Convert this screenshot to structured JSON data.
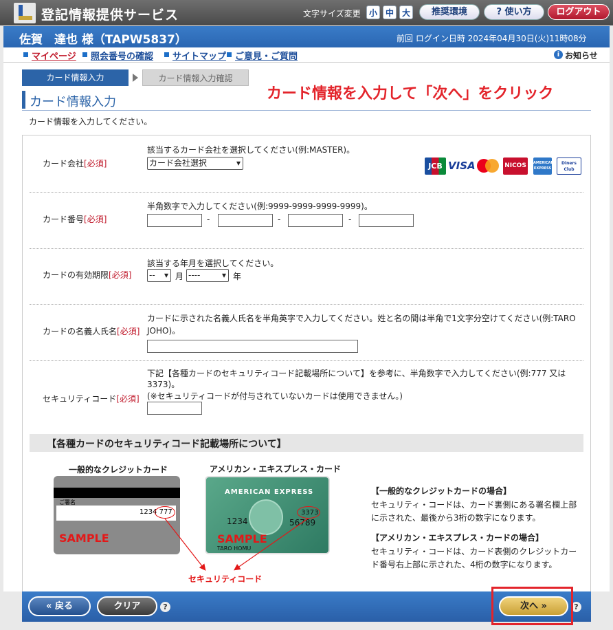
{
  "header": {
    "app_title": "登記情報提供サービス",
    "font_size_label": "文字サイズ変更",
    "font_small": "小",
    "font_medium": "中",
    "font_large": "大",
    "recommended_env": "推奨環境",
    "help": "使い方",
    "logout": "ログアウト"
  },
  "user": {
    "name": "佐賀　達也 様（TAPW5837）",
    "last_login": "前回 ログイン日時 2024年04月30日(火)11時08分"
  },
  "nav": {
    "mypage": "マイページ",
    "reference": "照会番号の確認",
    "sitemap": "サイトマップ",
    "feedback": "ご意見・ご質問",
    "notice": "お知らせ"
  },
  "steps": {
    "step1": "カード情報入力",
    "step2": "カード情報入力確認"
  },
  "annotation": "カード情報を入力して「次へ」をクリック",
  "page_title": "カード情報入力",
  "instruction": "カード情報を入力してください。",
  "form": {
    "required": "[必須]",
    "company": {
      "label": "カード会社",
      "hint": "該当するカード会社を選択してください(例:MASTER)。",
      "select": "カード会社選択"
    },
    "number": {
      "label": "カード番号",
      "hint": "半角数字で入力してください(例:9999-9999-9999-9999)。"
    },
    "expiry": {
      "label": "カードの有効期限",
      "hint": "該当する年月を選択してください。",
      "month_value": "--",
      "month_unit": "月",
      "year_value": "----",
      "year_unit": "年"
    },
    "holder": {
      "label": "カードの名義人氏名",
      "hint_line1": "カードに示された名義人氏名を半角英字で入力してください。姓と名の間は半角で1文字分空けてください(例:TARO",
      "hint_line2": "JOHO)。"
    },
    "security": {
      "label": "セキュリティコード",
      "hint_line1": "下記【各種カードのセキュリティコード記載場所について】を参考に、半角数字で入力してください(例:777 又は",
      "hint_line2": "3373)。",
      "hint_line3": "(※セキュリティコードが付与されていないカードは使用できません。)"
    }
  },
  "card_logos": [
    "JCB",
    "VISA",
    "MasterCard",
    "NICOS",
    "AMERICAN EXPRESS",
    "Diners Club"
  ],
  "security_info": {
    "heading": "【各種カードのセキュリティコード記載場所について】",
    "general_title": "一般的なクレジットカード",
    "amex_title": "アメリカン・エキスプレス・カード",
    "sig_label": "ご署名",
    "gen_digits": "1234 777",
    "sample": "SAMPLE",
    "amex_brand": "AMERICAN EXPRESS",
    "amex_1234": "1234",
    "amex_3373": "3373",
    "amex_56789": "56789",
    "amex_name": "TARO HOMU",
    "security_code_label": "セキュリティコード",
    "gen_case_title": "【一般的なクレジットカードの場合】",
    "gen_case_text": "セキュリティ・コードは、カード裏側にある署名欄上部に示された、最後から3桁の数字になります。",
    "amex_case_title": "【アメリカン・エキスプレス・カードの場合】",
    "amex_case_text": "セキュリティ・コードは、カード表側のクレジットカード番号右上部に示された、4桁の数字になります。"
  },
  "footer": {
    "back": "« 戻る",
    "clear": "クリア",
    "next": "次へ »",
    "help_mark": "?"
  },
  "colors": {
    "accent_blue": "#2c64a8",
    "required_red": "#c0182a",
    "annotation_red": "#e3242b",
    "next_gold": "#c9a035"
  }
}
